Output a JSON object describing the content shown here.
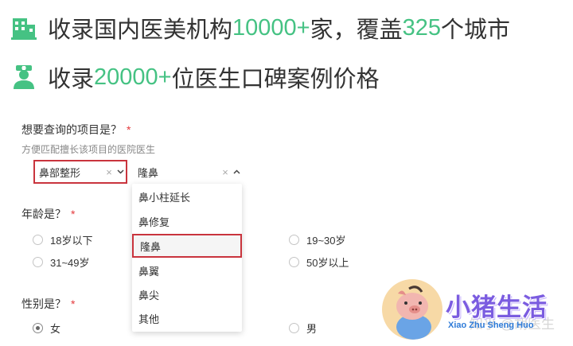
{
  "headline1": {
    "pre": "收录国内医美机构",
    "num1": "10000+",
    "mid": "家，覆盖",
    "num2": "325",
    "post": "个城市"
  },
  "headline2": {
    "pre": "收录",
    "num1": "20000+",
    "post": "位医生口碑案例价格"
  },
  "q1": {
    "label": "想要查询的项目是？",
    "required": "*",
    "hint": "方便匹配擅长该项目的医院医生"
  },
  "select1": {
    "value": "鼻部整形",
    "clear": "×",
    "chevron": "⌄"
  },
  "select2": {
    "value": "隆鼻",
    "clear": "×",
    "chevron": "⌃"
  },
  "dropdown": {
    "options": [
      "鼻小柱延长",
      "鼻修复",
      "隆鼻",
      "鼻翼",
      "鼻尖",
      "其他"
    ],
    "selected": "隆鼻"
  },
  "q2": {
    "label": "年龄是？",
    "required": "*",
    "options": [
      "18岁以下",
      "19~30岁",
      "31~49岁",
      "50岁以上"
    ]
  },
  "q3": {
    "label": "性别是？",
    "required": "*",
    "options": [
      "女",
      "男"
    ],
    "selected": "女"
  },
  "watermark": "知乎 @胡医生",
  "logo": {
    "title": "小猪生活",
    "subtitle": "Xiao Zhu Sheng Huo"
  },
  "colors": {
    "accent": "#45c283",
    "highlight_border": "#c9343d",
    "logo_purple": "#7b5ce0",
    "logo_blue": "#2e7bd8"
  },
  "icons": {
    "building": "building-icon",
    "doctor": "doctor-icon"
  }
}
